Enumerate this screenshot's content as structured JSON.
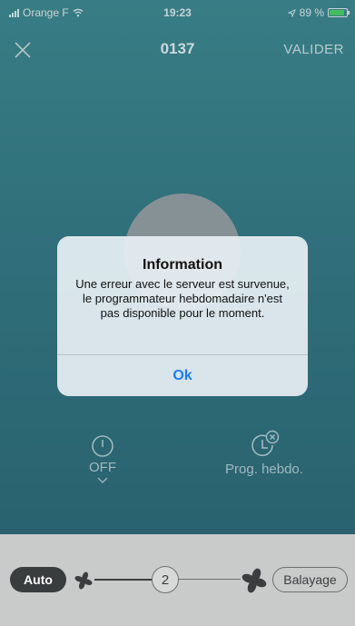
{
  "status_bar": {
    "carrier": "Orange F",
    "time": "19:23",
    "battery": "89 %",
    "battery_level": 0.89
  },
  "nav": {
    "title": "0137",
    "validate_label": "VALIDER",
    "close_icon": "close-icon"
  },
  "controls": {
    "power_label": "OFF",
    "power_icon": "power-icon",
    "prog_label": "Prog. hebdo.",
    "prog_icon": "clock-cancel-icon"
  },
  "bottom_bar": {
    "mode_label": "Auto",
    "fan_speed": "2",
    "sweep_label": "Balayage",
    "fan_speed_level": 0.5
  },
  "dialog": {
    "title": "Information",
    "message": "Une erreur avec le serveur est survenue, le programmateur hebdomadaire n'est pas disponible pour le moment.",
    "ok_label": "Ok"
  },
  "colors": {
    "background_teal": "#357b86",
    "accent_blue": "#1a7cf5",
    "bottom_bar": "#c9cbcb"
  }
}
